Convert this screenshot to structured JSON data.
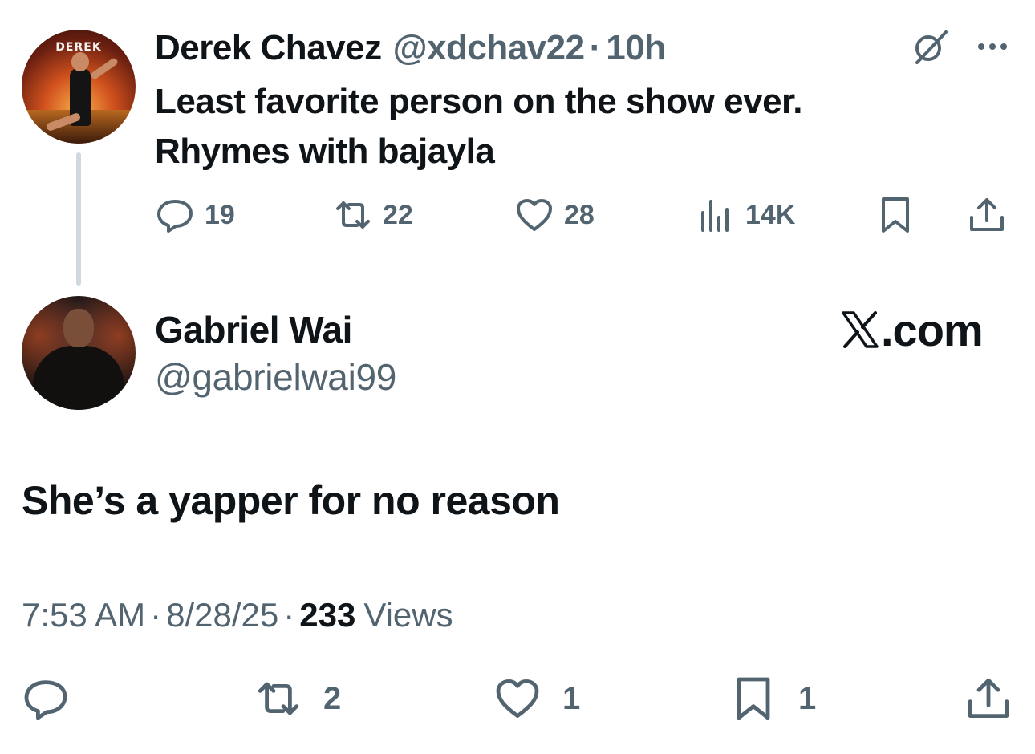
{
  "parent_tweet": {
    "author_name": "Derek Chavez",
    "handle": "@xdchav22",
    "separator": "·",
    "time": "10h",
    "avatar_label": "DEREK",
    "text_line1": "Least favorite person on the show ever.",
    "text_line2": "Rhymes with bajayla",
    "replies": "19",
    "reposts": "22",
    "likes": "28",
    "views": "14K",
    "icons": [
      "reply-icon",
      "repost-icon",
      "like-icon",
      "views-icon",
      "bookmark-icon",
      "share-icon",
      "grok-icon",
      "more-icon"
    ]
  },
  "reply_tweet": {
    "author_name": "Gabriel Wai",
    "handle": "@gabrielwai99",
    "watermark": ".com",
    "text": "She’s a yapper for no reason",
    "time": "7:53 AM",
    "separator": "·",
    "date": "8/28/25",
    "views_count": "233",
    "views_label": "Views",
    "reposts": "2",
    "likes": "1",
    "bookmarks": "1",
    "icons": [
      "reply-icon",
      "repost-icon",
      "like-icon",
      "bookmark-icon",
      "share-icon",
      "x-logo-icon"
    ]
  },
  "colors": {
    "text_primary": "#0f1419",
    "text_secondary": "#536471",
    "thread_line": "#cfd9de"
  }
}
